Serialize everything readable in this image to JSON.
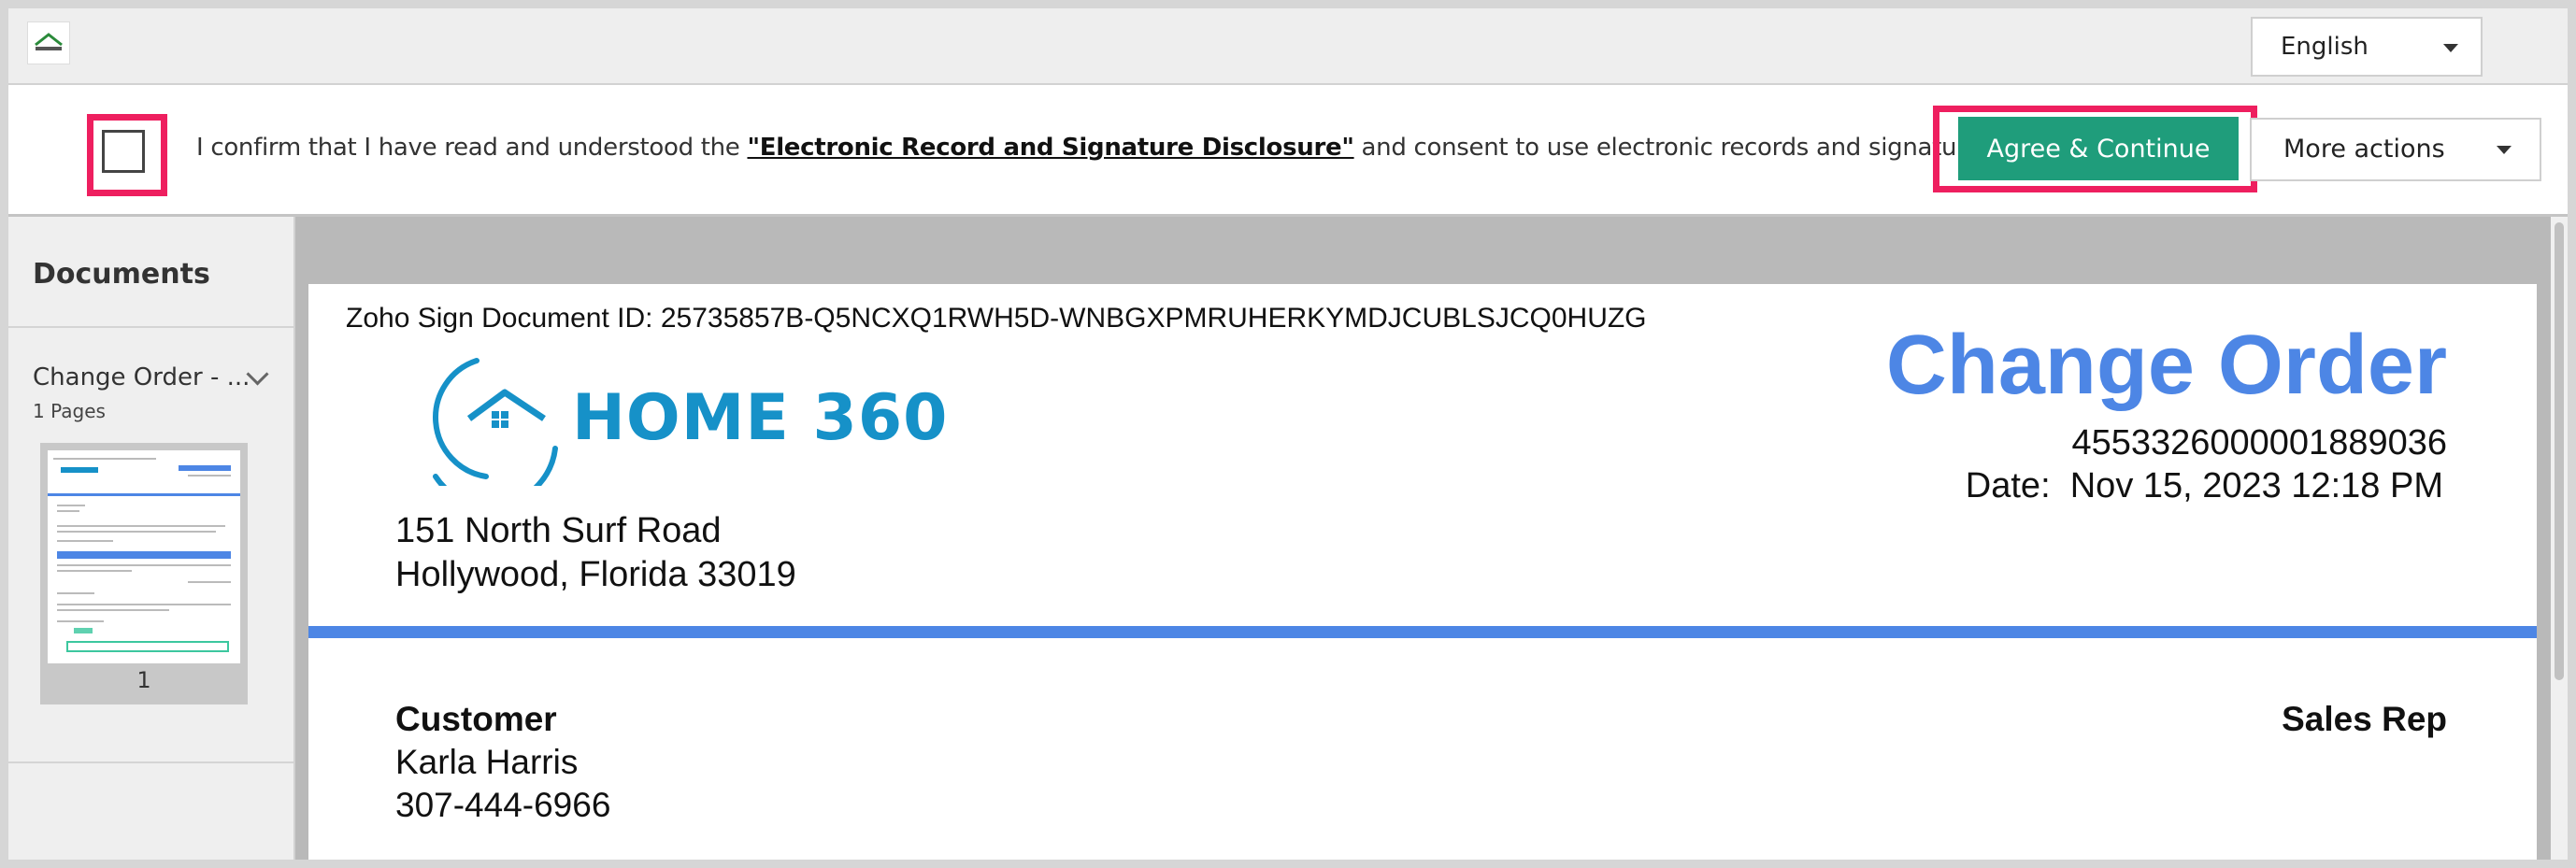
{
  "header": {
    "language": "English"
  },
  "consent": {
    "text_before": "I confirm that I have read and understood the ",
    "disclosure_link": "\"Electronic Record and Signature Disclosure\"",
    "text_after": " and consent to use electronic records and signatures.",
    "agree_button": "Agree & Continue",
    "more_actions": "More actions",
    "highlight_color": "#ee1f5f",
    "agree_color": "#1f9d7b"
  },
  "sidebar": {
    "title": "Documents",
    "document_name": "Change Order - ...",
    "page_count": "1 Pages",
    "thumbnail_page": "1"
  },
  "document": {
    "doc_id": "Zoho Sign Document ID: 25735857B-Q5NCXQ1RWH5D-WNBGXPMRUHERKYMDJCUBLSJCQ0HUZG",
    "brand": "HOME 360",
    "title": "Change Order",
    "number": "4553326000001889036",
    "date": "Date:  Nov 15, 2023 12:18 PM",
    "address_line1": "151 North Surf Road",
    "address_line2": "Hollywood, Florida 33019",
    "customer_label": "Customer",
    "customer_name": "Karla Harris",
    "customer_phone": "307-444-6966",
    "sales_rep_label": "Sales Rep",
    "accent_color": "#4d86e5",
    "brand_color": "#1691c8"
  }
}
